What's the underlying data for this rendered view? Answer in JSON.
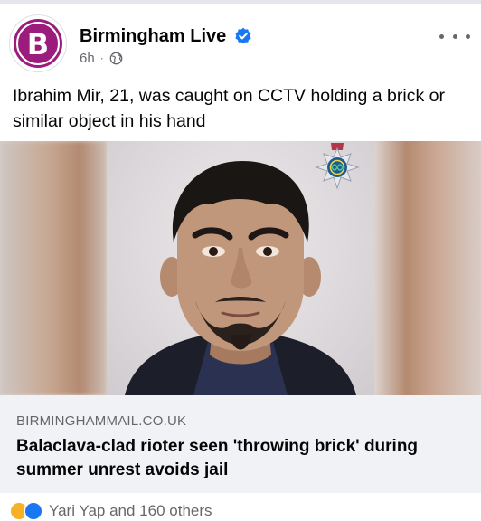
{
  "post": {
    "page_name": "Birmingham Live",
    "avatar_letter": "B",
    "time": "6h",
    "separator": "·",
    "caption": "Ibrahim Mir, 21, was caught on CCTV holding a brick or similar object in his hand"
  },
  "link": {
    "domain": "BIRMINGHAMMAIL.CO.UK",
    "headline": "Balaclava-clad rioter seen 'throwing brick' during summer unrest avoids jail"
  },
  "reactions": {
    "summary": "Yari Yap and 160 others"
  },
  "colors": {
    "brand_avatar": "#9b1c7d",
    "verified": "#1877f2",
    "secondary_text": "#65676b",
    "link_box_bg": "#f0f2f5"
  },
  "icons": {
    "verified": "verified-badge-icon",
    "audience": "globe-icon",
    "more": "more-options-icon"
  }
}
